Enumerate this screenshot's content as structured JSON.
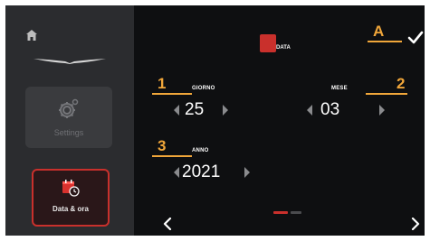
{
  "sidebar": {
    "settings_label": "Settings",
    "date_label": "Data & ora"
  },
  "header": {
    "logo_text": "DATA"
  },
  "callouts": {
    "a": "A",
    "one": "1",
    "two": "2",
    "three": "3"
  },
  "fields": {
    "day": {
      "label": "GIORNO",
      "value": "25"
    },
    "month": {
      "label": "MESE",
      "value": "03"
    },
    "year": {
      "label": "ANNO",
      "value": "2021"
    }
  },
  "pager": {
    "pages": 2,
    "active_page": 1
  },
  "colors": {
    "accent": "#c9302c",
    "callout": "#f0a63a",
    "background": "#0e0f11",
    "sidebar": "#2b2c2f"
  },
  "icons": [
    "home-icon",
    "brand-wings-icon",
    "gear-icon",
    "calendar-clock-icon",
    "checkmark-icon",
    "chevron-left-icon",
    "chevron-right-icon"
  ]
}
